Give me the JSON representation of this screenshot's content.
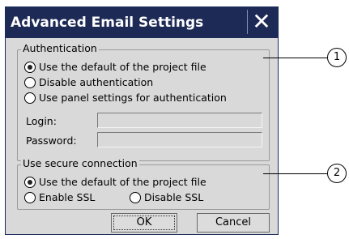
{
  "dialog": {
    "title": "Advanced Email Settings",
    "close_glyph": "✕"
  },
  "authentication": {
    "label": "Authentication",
    "options": [
      {
        "label": "Use the default of the project file",
        "checked": true
      },
      {
        "label": "Disable authentication",
        "checked": false
      },
      {
        "label": "Use panel settings for authentication",
        "checked": false
      }
    ],
    "login_label": "Login:",
    "login_value": "",
    "password_label": "Password:",
    "password_value": ""
  },
  "secure_connection": {
    "label": "Use secure connection",
    "options": [
      {
        "label": "Use the default of the project file",
        "checked": true
      },
      {
        "label": "Enable SSL",
        "checked": false
      },
      {
        "label": "Disable SSL",
        "checked": false
      }
    ]
  },
  "buttons": {
    "ok": "OK",
    "cancel": "Cancel"
  },
  "callouts": [
    "1",
    "2"
  ]
}
